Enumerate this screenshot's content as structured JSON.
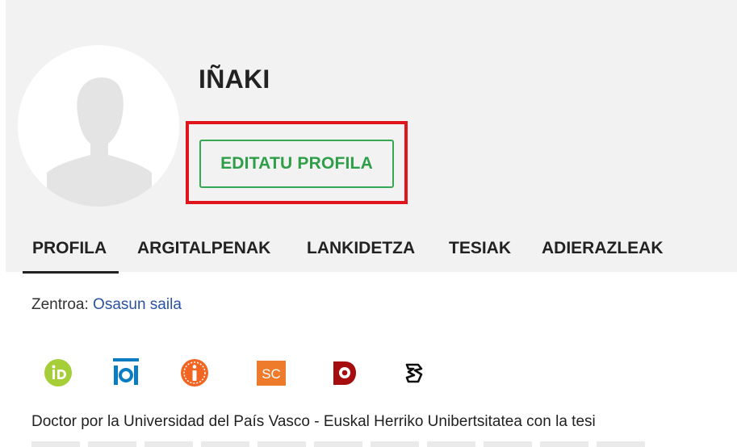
{
  "profile": {
    "name": "IÑAKI",
    "edit_button_label": "EDITATU PROFILA"
  },
  "tabs": [
    {
      "label": "PROFILA",
      "active": true
    },
    {
      "label": "ARGITALPENAK",
      "active": false
    },
    {
      "label": "LANKIDETZA",
      "active": false
    },
    {
      "label": "TESIAK",
      "active": false
    },
    {
      "label": "ADIERAZLEAK",
      "active": false
    }
  ],
  "center": {
    "label": "Zentroa:",
    "value": "Osasun saila"
  },
  "identifier_icons": [
    {
      "name": "orcid-icon",
      "color": "#a6ce39"
    },
    {
      "name": "ioi-icon",
      "color": "#0a7dc2"
    },
    {
      "name": "info-icon",
      "color": "#f26522"
    },
    {
      "name": "scopus-icon",
      "color": "#ee7a2c"
    },
    {
      "name": "dialnet-icon",
      "color": "#a50e0e"
    },
    {
      "name": "ai-icon",
      "color": "#111111"
    }
  ],
  "bio": {
    "text": "Doctor por la Universidad del País Vasco - Euskal Herriko Unibertsitatea con la tesi"
  },
  "colors": {
    "highlight": "#e0141d",
    "edit_button": "#36a853",
    "link": "#2952a3",
    "header_bg": "#f2f2f2"
  }
}
